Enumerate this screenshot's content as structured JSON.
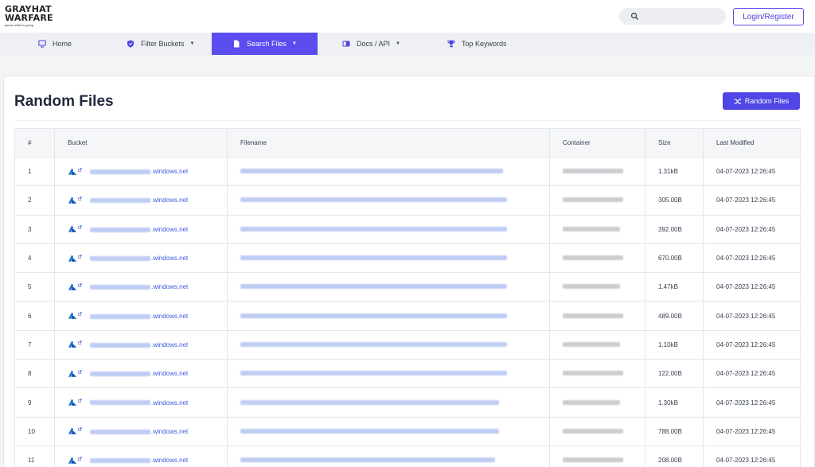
{
  "brand": {
    "line1": "GRAYHAT",
    "line2": "WARFARE",
    "tagline": "pause while is going"
  },
  "header": {
    "search_placeholder": "",
    "login_label": "Login/Register"
  },
  "nav": [
    {
      "label": "Home",
      "icon": "monitor-icon",
      "dropdown": false
    },
    {
      "label": "Filter Buckets",
      "icon": "shield-icon",
      "dropdown": true
    },
    {
      "label": "Search Files",
      "icon": "file-icon",
      "dropdown": true,
      "active": true
    },
    {
      "label": "Docs / API",
      "icon": "book-icon",
      "dropdown": true
    },
    {
      "label": "Top Keywords",
      "icon": "trophy-icon",
      "dropdown": false
    }
  ],
  "page": {
    "title": "Random Files",
    "random_button_label": "Random Files"
  },
  "table": {
    "headers": [
      "#",
      "Bucket",
      "Filename",
      "Container",
      "Size",
      "Last Modified"
    ],
    "bucket_suffix": ".windows.net",
    "rows": [
      {
        "num": "1",
        "size": "1.31kB",
        "modified": "04-07-2023 12:26:45"
      },
      {
        "num": "2",
        "size": "305.00B",
        "modified": "04-07-2023 12:26:45"
      },
      {
        "num": "3",
        "size": "392.00B",
        "modified": "04-07-2023 12:26:45"
      },
      {
        "num": "4",
        "size": "670.00B",
        "modified": "04-07-2023 12:26:45"
      },
      {
        "num": "5",
        "size": "1.47kB",
        "modified": "04-07-2023 12:26:45"
      },
      {
        "num": "6",
        "size": "489.00B",
        "modified": "04-07-2023 12:26:45"
      },
      {
        "num": "7",
        "size": "1.10kB",
        "modified": "04-07-2023 12:26:45"
      },
      {
        "num": "8",
        "size": "122.00B",
        "modified": "04-07-2023 12:26:45"
      },
      {
        "num": "9",
        "size": "1.30kB",
        "modified": "04-07-2023 12:26:45"
      },
      {
        "num": "10",
        "size": "788.00B",
        "modified": "04-07-2023 12:26:45"
      },
      {
        "num": "11",
        "size": "208.00B",
        "modified": "04-07-2023 12:26:45"
      }
    ]
  },
  "colors": {
    "accent": "#5b4cf0",
    "link": "#3b5bdb",
    "nav_bg": "#eef0f3",
    "page_bg": "#f3f4f6"
  }
}
